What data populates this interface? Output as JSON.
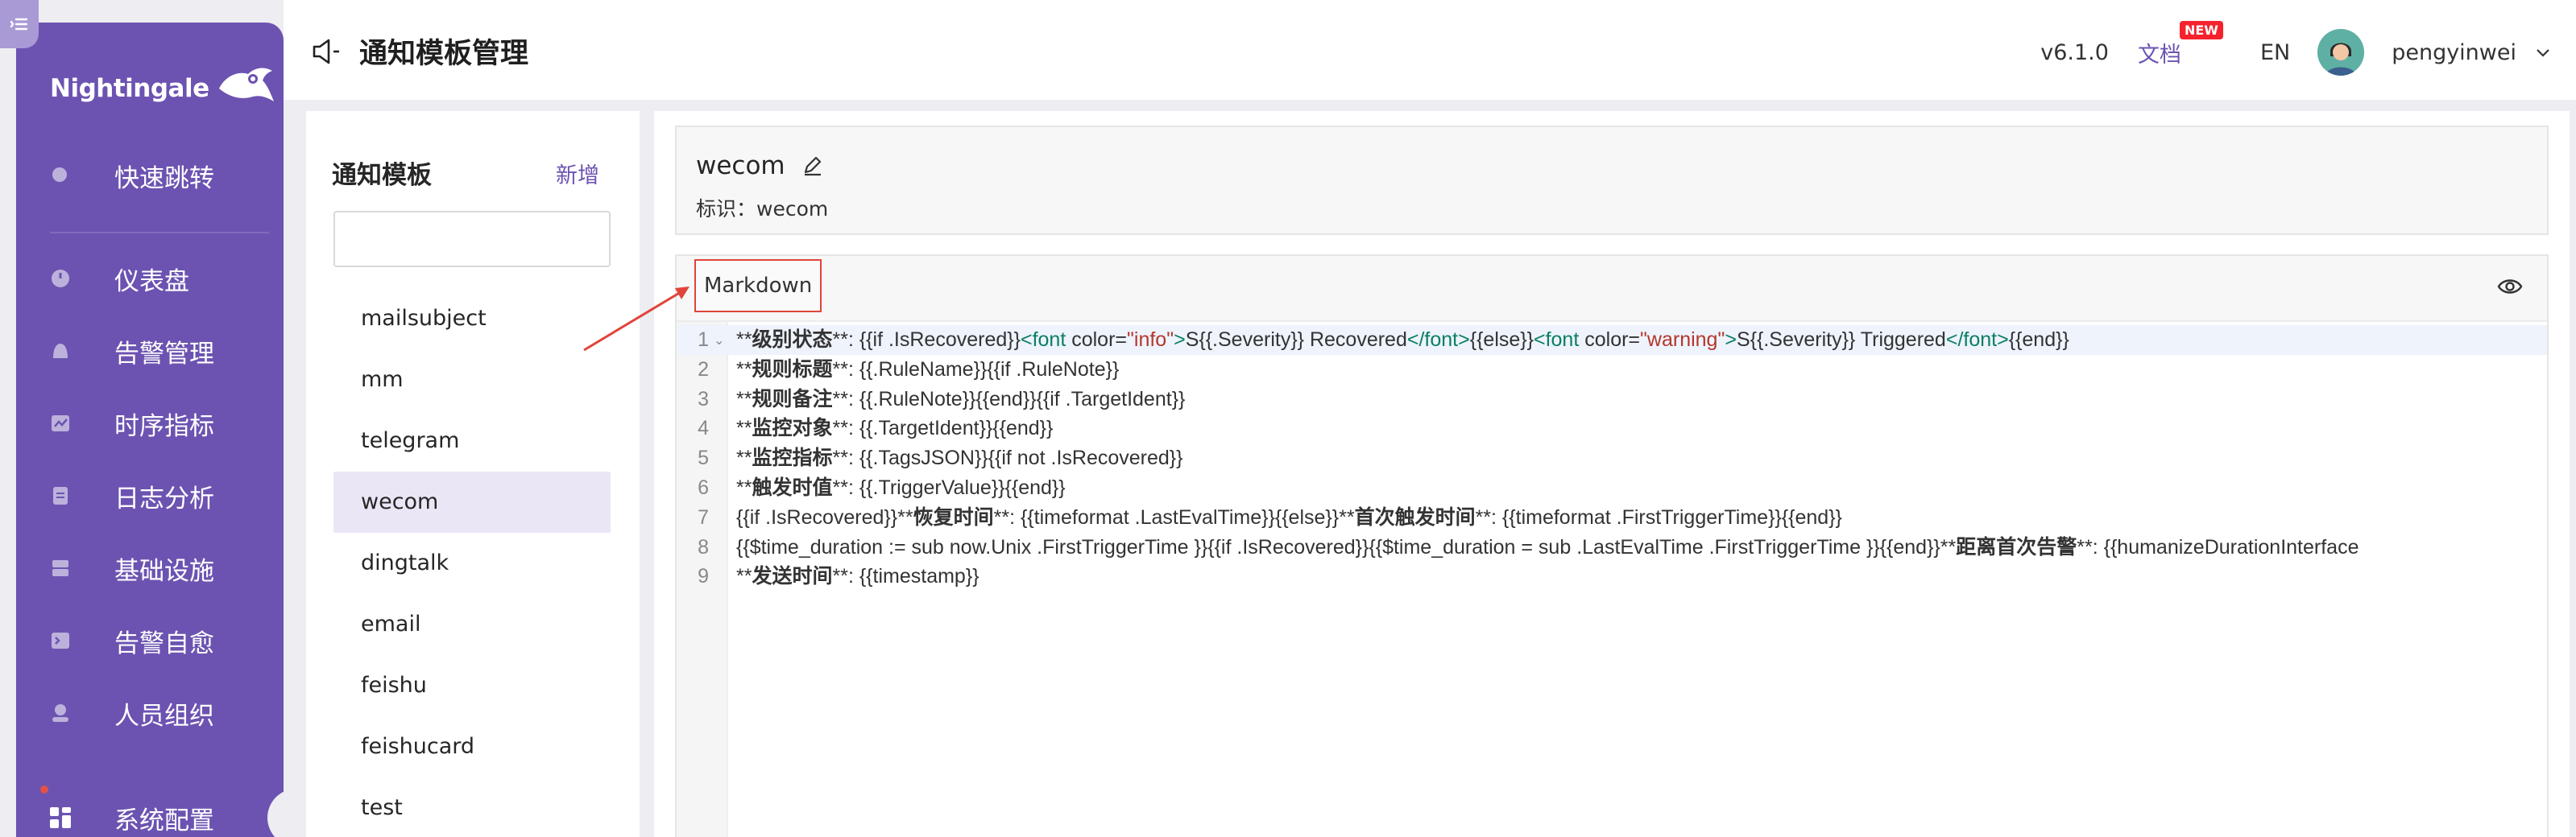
{
  "app": {
    "logo_text": "Nightingale",
    "page_title": "通知模板管理",
    "version": "v6.1.0",
    "docs_label": "文档",
    "new_badge": "NEW",
    "lang": "EN",
    "username": "pengyinwei",
    "brand_color": "#6c53b1"
  },
  "sidebar": {
    "items": [
      {
        "label": "快速跳转",
        "icon": "search-icon"
      },
      {
        "label": "仪表盘",
        "icon": "dashboard-icon"
      },
      {
        "label": "告警管理",
        "icon": "alarm-icon"
      },
      {
        "label": "时序指标",
        "icon": "chart-line-icon"
      },
      {
        "label": "日志分析",
        "icon": "document-icon"
      },
      {
        "label": "基础设施",
        "icon": "server-icon"
      },
      {
        "label": "告警自愈",
        "icon": "terminal-icon"
      },
      {
        "label": "人员组织",
        "icon": "user-icon"
      },
      {
        "label": "系统配置",
        "icon": "grid-icon",
        "active": true
      }
    ]
  },
  "templates": {
    "title": "通知模板",
    "add_label": "新增",
    "search_placeholder": "",
    "items": [
      "mailsubject",
      "mm",
      "telegram",
      "wecom",
      "dingtalk",
      "email",
      "feishu",
      "feishucard",
      "test"
    ],
    "selected": "wecom"
  },
  "detail": {
    "name": "wecom",
    "ident_label": "标识：",
    "ident_value": "wecom",
    "tab_label": "Markdown"
  },
  "editor": {
    "line_numbers": [
      "1",
      "2",
      "3",
      "4",
      "5",
      "6",
      "7",
      "8",
      "9"
    ],
    "lines": [
      [
        [
          "n",
          "**"
        ],
        [
          "b",
          "级别状态"
        ],
        [
          "n",
          "**: {{if .IsRecovered}}"
        ],
        [
          "t",
          "<font "
        ],
        [
          "n",
          "color="
        ],
        [
          "s",
          "\"info\""
        ],
        [
          "t",
          ">"
        ],
        [
          "n",
          "S{{.Severity}} Recovered"
        ],
        [
          "t",
          "</font>"
        ],
        [
          "n",
          "{{else}}"
        ],
        [
          "t",
          "<font "
        ],
        [
          "n",
          "color="
        ],
        [
          "s",
          "\"warning\""
        ],
        [
          "t",
          ">"
        ],
        [
          "n",
          "S{{.Severity}} Triggered"
        ],
        [
          "t",
          "</font>"
        ],
        [
          "n",
          "{{end}}"
        ]
      ],
      [
        [
          "n",
          "**"
        ],
        [
          "b",
          "规则标题"
        ],
        [
          "n",
          "**: {{.RuleName}}{{if .RuleNote}}"
        ]
      ],
      [
        [
          "n",
          "**"
        ],
        [
          "b",
          "规则备注"
        ],
        [
          "n",
          "**: {{.RuleNote}}{{end}}{{if .TargetIdent}}"
        ]
      ],
      [
        [
          "n",
          "**"
        ],
        [
          "b",
          "监控对象"
        ],
        [
          "n",
          "**: {{.TargetIdent}}{{end}}"
        ]
      ],
      [
        [
          "n",
          "**"
        ],
        [
          "b",
          "监控指标"
        ],
        [
          "n",
          "**: {{.TagsJSON}}{{if not .IsRecovered}}"
        ]
      ],
      [
        [
          "n",
          "**"
        ],
        [
          "b",
          "触发时值"
        ],
        [
          "n",
          "**: {{.TriggerValue}}{{end}}"
        ]
      ],
      [
        [
          "n",
          "{{if .IsRecovered}}**"
        ],
        [
          "b",
          "恢复时间"
        ],
        [
          "n",
          "**: {{timeformat .LastEvalTime}}{{else}}**"
        ],
        [
          "b",
          "首次触发时间"
        ],
        [
          "n",
          "**: {{timeformat .FirstTriggerTime}}{{end}}"
        ]
      ],
      [
        [
          "n",
          "{{$time_duration := sub now.Unix .FirstTriggerTime }}{{if .IsRecovered}}{{$time_duration = sub .LastEvalTime .FirstTriggerTime }}{{end}}**"
        ],
        [
          "b",
          "距离首次告警"
        ],
        [
          "n",
          "**: {{humanizeDurationInterface"
        ]
      ],
      [
        [
          "n",
          "**"
        ],
        [
          "b",
          "发送时间"
        ],
        [
          "n",
          "**: {{timestamp}}"
        ]
      ]
    ]
  }
}
